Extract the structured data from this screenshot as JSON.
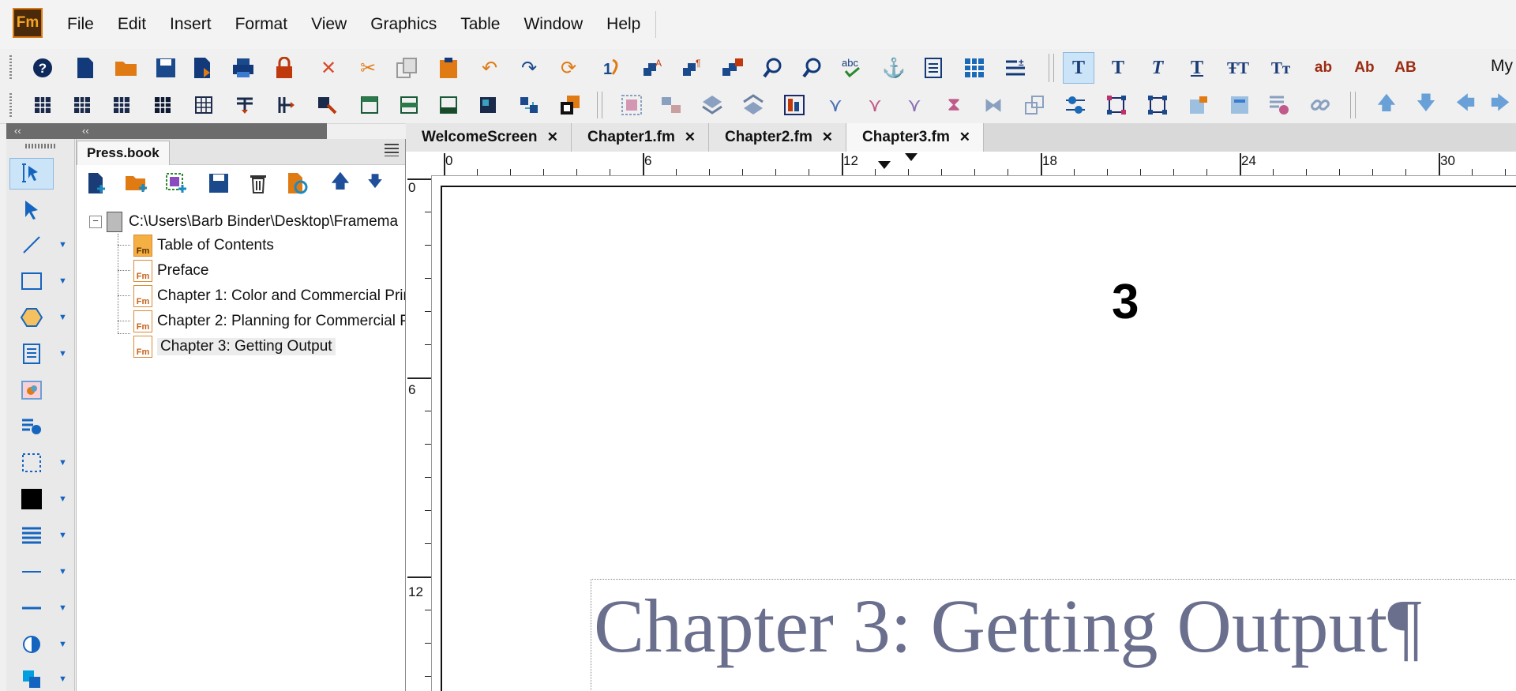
{
  "app": {
    "logo_text": "Fm"
  },
  "menu": [
    "File",
    "Edit",
    "Insert",
    "Format",
    "View",
    "Graphics",
    "Table",
    "Window",
    "Help"
  ],
  "toolbar": {
    "format_buttons": [
      "T",
      "T",
      "T",
      "T",
      "ŦT",
      "Tт",
      "ab",
      "Ab",
      "AB"
    ],
    "workspace_label": "My"
  },
  "book_panel": {
    "tab_label": "Press.book",
    "root_path": "C:\\Users\\Barb Binder\\Desktop\\Framema",
    "items": [
      {
        "label": "Table of Contents",
        "icon": "fm-toc-icon"
      },
      {
        "label": "Preface",
        "icon": "fm-file-icon"
      },
      {
        "label": "Chapter 1: Color and Commercial Prir",
        "icon": "fm-file-icon"
      },
      {
        "label": "Chapter 2: Planning for Commercial P",
        "icon": "fm-file-icon"
      },
      {
        "label": "Chapter 3: Getting Output",
        "icon": "fm-file-icon",
        "selected": true
      }
    ]
  },
  "doc_tabs": [
    {
      "label": "WelcomeScreen"
    },
    {
      "label": "Chapter1.fm"
    },
    {
      "label": "Chapter2.fm"
    },
    {
      "label": "Chapter3.fm",
      "active": true
    }
  ],
  "ruler": {
    "horizontal_labels": [
      "0",
      "6",
      "12",
      "18",
      "24",
      "30"
    ],
    "vertical_labels": [
      "0",
      "6",
      "12"
    ]
  },
  "document": {
    "chapter_number": "3",
    "chapter_title": "Chapter 3: Getting Output¶",
    "title_color": "#6b6f8e"
  },
  "colors": {
    "accent": "#1565c0",
    "selection": "#cce4f7",
    "logo_bg": "#4a2a0a",
    "logo_fg": "#f4a623"
  }
}
